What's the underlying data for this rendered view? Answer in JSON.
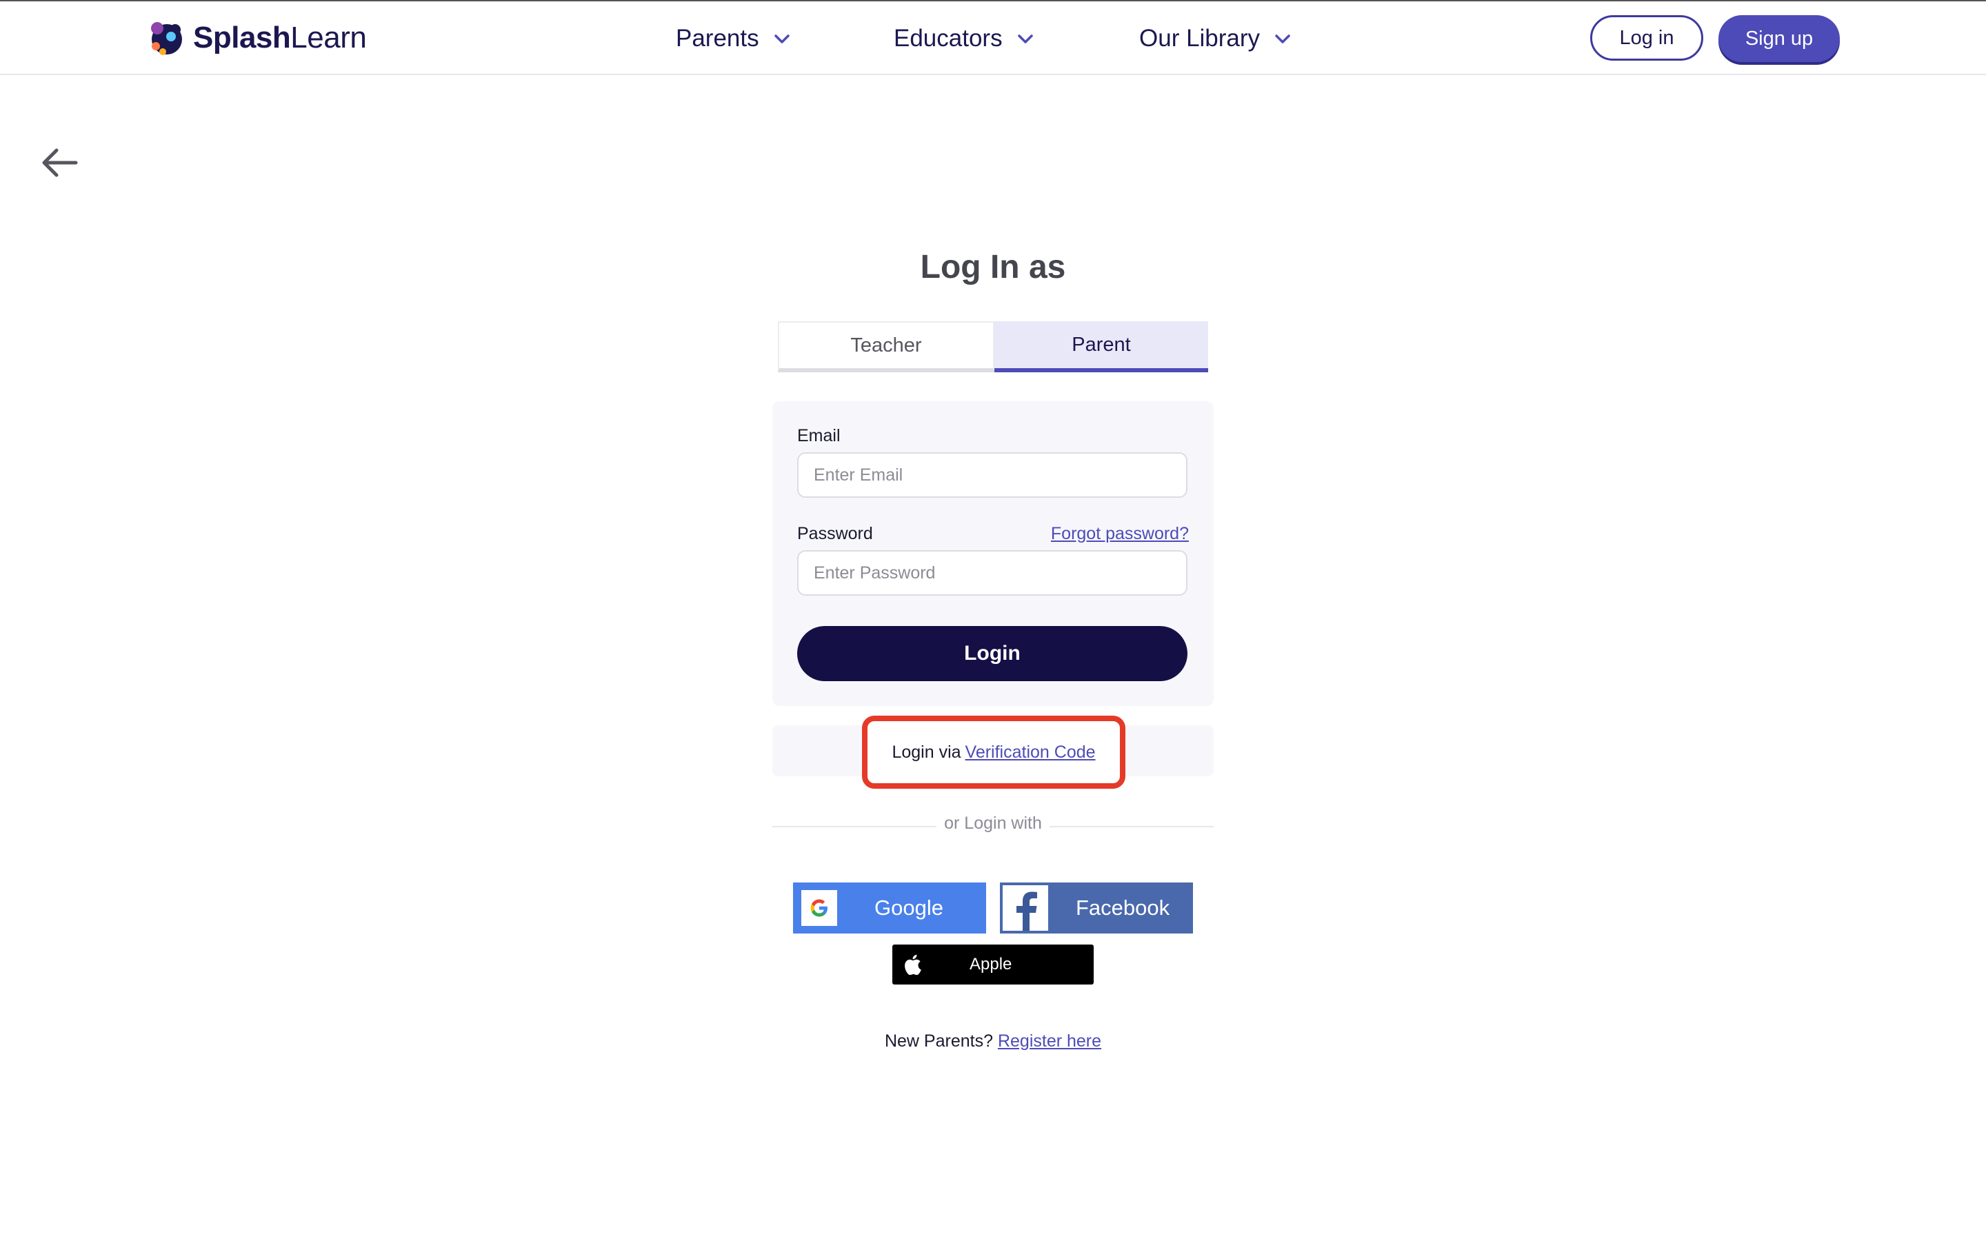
{
  "brand": {
    "name_bold": "Splash",
    "name_light": "Learn"
  },
  "nav": {
    "items": [
      {
        "label": "Parents"
      },
      {
        "label": "Educators"
      },
      {
        "label": "Our Library"
      }
    ],
    "login_label": "Log in",
    "signup_label": "Sign up"
  },
  "page": {
    "title": "Log In as"
  },
  "tabs": [
    {
      "label": "Teacher",
      "active": false
    },
    {
      "label": "Parent",
      "active": true
    }
  ],
  "form": {
    "email_label": "Email",
    "email_placeholder": "Enter Email",
    "password_label": "Password",
    "password_placeholder": "Enter Password",
    "forgot_label": "Forgot password?",
    "login_button": "Login"
  },
  "verification": {
    "prefix": "Login via",
    "link": "Verification Code"
  },
  "alt_login": {
    "or_text": "or Login with",
    "google": "Google",
    "facebook": "Facebook",
    "apple": "Apple"
  },
  "register": {
    "prefix": "New Parents?",
    "link": "Register here"
  },
  "colors": {
    "accent": "#4d4bb8",
    "primary_dark": "#141046",
    "highlight": "#e53a27",
    "google": "#4a80ea",
    "facebook": "#4a69ac"
  }
}
